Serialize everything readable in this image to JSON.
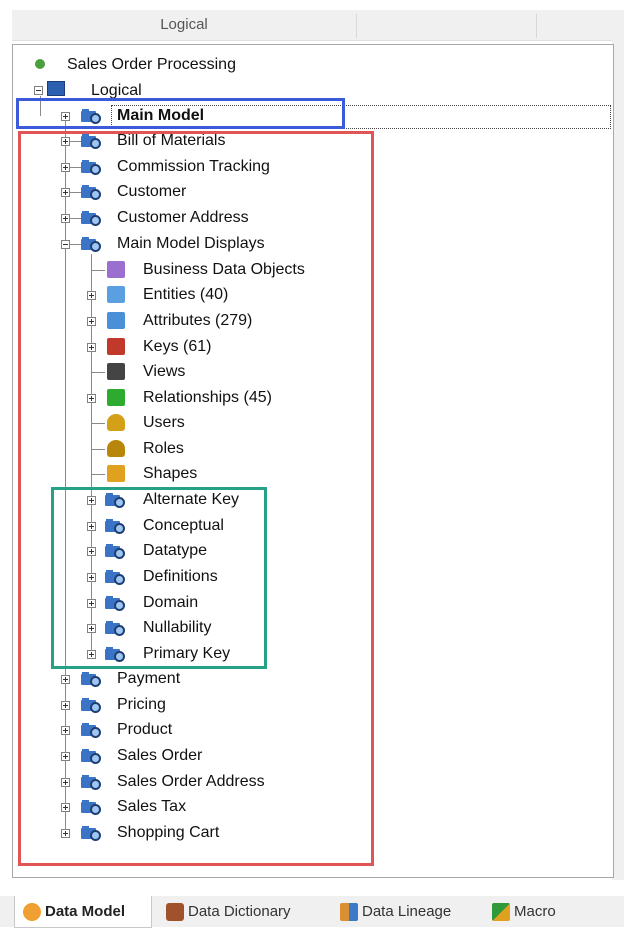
{
  "panel": {
    "title": "Logical"
  },
  "tree": {
    "root": "Sales Order Processing",
    "logical": "Logical",
    "main_model": "Main Model",
    "level1_a": [
      "Bill of Materials",
      "Commission Tracking",
      "Customer",
      "Customer Address",
      "Main Model Displays"
    ],
    "displays_children": [
      {
        "label": "Business Data Objects",
        "icon": "business-data-objects-icon",
        "expandable": false
      },
      {
        "label": "Entities (40)",
        "icon": "entities-icon",
        "expandable": true
      },
      {
        "label": "Attributes (279)",
        "icon": "attributes-icon",
        "expandable": true
      },
      {
        "label": "Keys (61)",
        "icon": "keys-icon",
        "expandable": true
      },
      {
        "label": "Views",
        "icon": "views-icon",
        "expandable": false
      },
      {
        "label": "Relationships (45)",
        "icon": "relationships-icon",
        "expandable": true
      },
      {
        "label": "Users",
        "icon": "users-icon",
        "expandable": false
      },
      {
        "label": "Roles",
        "icon": "roles-icon",
        "expandable": false
      },
      {
        "label": "Shapes",
        "icon": "shapes-icon",
        "expandable": false
      },
      {
        "label": "Alternate Key",
        "icon": "model-folder-icon",
        "expandable": true
      },
      {
        "label": "Conceptual",
        "icon": "model-folder-icon",
        "expandable": true
      },
      {
        "label": "Datatype",
        "icon": "model-folder-icon",
        "expandable": true
      },
      {
        "label": "Definitions",
        "icon": "model-folder-icon",
        "expandable": true
      },
      {
        "label": "Domain",
        "icon": "model-folder-icon",
        "expandable": true
      },
      {
        "label": "Nullability",
        "icon": "model-folder-icon",
        "expandable": true
      },
      {
        "label": "Primary Key",
        "icon": "model-folder-icon",
        "expandable": true
      }
    ],
    "level1_b": [
      "Payment",
      "Pricing",
      "Product",
      "Sales Order",
      "Sales Order Address",
      "Sales Tax",
      "Shopping Cart"
    ]
  },
  "tabs": [
    {
      "label": "Data Model",
      "icon": "data-model-icon",
      "active": true
    },
    {
      "label": "Data Dictionary",
      "icon": "data-dictionary-icon",
      "active": false
    },
    {
      "label": "Data Lineage",
      "icon": "data-lineage-icon",
      "active": false
    },
    {
      "label": "Macro",
      "icon": "macro-icon",
      "active": false
    }
  ],
  "colors": {
    "highlight_blue": "#3b5bdb",
    "highlight_red": "#e05555",
    "highlight_green": "#26a186"
  }
}
